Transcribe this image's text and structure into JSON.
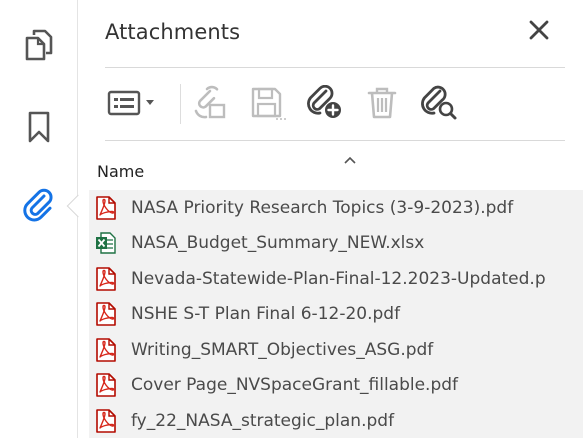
{
  "rail": {
    "items": [
      {
        "icon": "pages-icon",
        "active": false
      },
      {
        "icon": "bookmark-icon",
        "active": false
      },
      {
        "icon": "paperclip-icon",
        "active": true
      }
    ],
    "active_color": "#1473e6",
    "icon_color": "#555555"
  },
  "panel": {
    "title": "Attachments",
    "close_icon": "close-icon"
  },
  "toolbar": {
    "items": [
      {
        "icon": "list-view-icon",
        "enabled": true
      },
      {
        "icon": "open-attachment-icon",
        "enabled": false
      },
      {
        "icon": "save-attachment-icon",
        "enabled": false
      },
      {
        "icon": "add-attachment-icon",
        "enabled": true
      },
      {
        "icon": "delete-icon",
        "enabled": false
      },
      {
        "icon": "search-attachment-icon",
        "enabled": true
      }
    ]
  },
  "list": {
    "column_header": "Name",
    "sort": "ascending",
    "files": [
      {
        "name": "NASA Priority Research Topics (3-9-2023).pdf",
        "type": "pdf"
      },
      {
        "name": "NASA_Budget_Summary_NEW.xlsx",
        "type": "xlsx"
      },
      {
        "name": "Nevada-Statewide-Plan-Final-12.2023-Updated.p",
        "type": "pdf"
      },
      {
        "name": "NSHE S-T Plan Final 6-12-20.pdf",
        "type": "pdf"
      },
      {
        "name": "Writing_SMART_Objectives_ASG.pdf",
        "type": "pdf"
      },
      {
        "name": "Cover Page_NVSpaceGrant_fillable.pdf",
        "type": "pdf"
      },
      {
        "name": "fy_22_NASA_strategic_plan.pdf",
        "type": "pdf"
      }
    ]
  }
}
